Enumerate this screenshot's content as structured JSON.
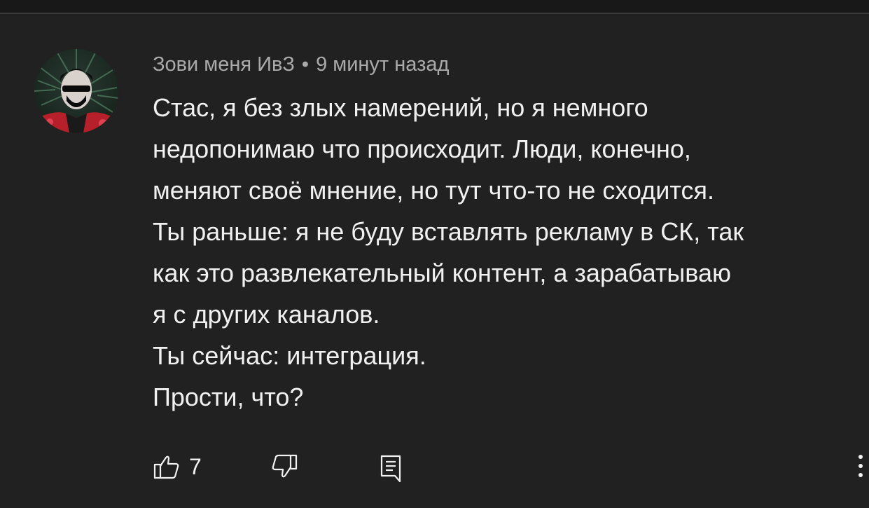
{
  "comment": {
    "author": "Зови меня ИвЗ",
    "separator": "•",
    "time": "9 минут назад",
    "lines": [
      "Стас, я без злых намерений, но я немного",
      "недопонимаю что происходит. Люди, конечно,",
      "меняют своё мнение, но тут что-то не сходится.",
      "Ты раньше: я не буду вставлять рекламу в СК, так",
      "как это развлекательный контент, а зарабатываю",
      "я с других каналов.",
      "Ты сейчас: интеграция.",
      "Прости, что?"
    ],
    "likes": "7"
  },
  "icons": {
    "avatar": "avatar-image",
    "like": "thumbs-up-icon",
    "dislike": "thumbs-down-icon",
    "reply": "reply-comment-icon",
    "more": "more-vertical-icon"
  },
  "colors": {
    "background": "#212121",
    "text": "#f1f1f1",
    "meta": "#aaaaaa"
  }
}
